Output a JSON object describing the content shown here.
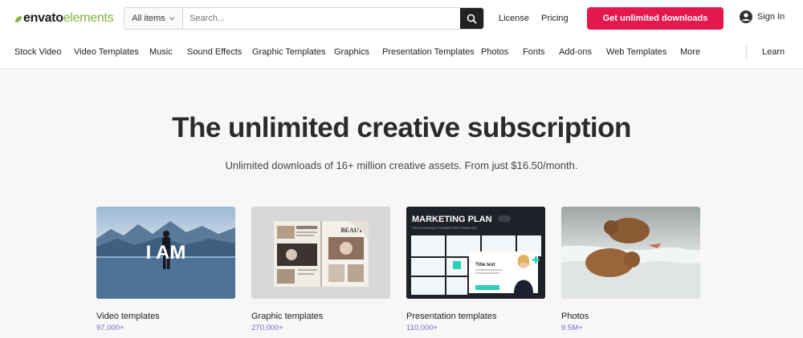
{
  "brand": {
    "logo_part1": "envato",
    "logo_part2": "elements",
    "accent": "#82b541",
    "cta_color": "#e4174f"
  },
  "search": {
    "category": "All items",
    "placeholder": "Search..."
  },
  "header": {
    "license": "License",
    "pricing": "Pricing",
    "cta": "Get unlimited downloads",
    "signin": "Sign In"
  },
  "nav": {
    "items": [
      "Stock Video",
      "Video Templates",
      "Music",
      "Sound Effects",
      "Graphic Templates",
      "Graphics",
      "Presentation Templates",
      "Photos",
      "Fonts",
      "Add-ons",
      "Web Templates",
      "More"
    ],
    "learn": "Learn"
  },
  "hero": {
    "title": "The unlimited creative subscription",
    "subtitle": "Unlimited downloads of 16+ million creative assets. From just $16.50/month."
  },
  "cards": [
    {
      "title": "Video templates",
      "count": "97,000+",
      "overlay": "I AM"
    },
    {
      "title": "Graphic templates",
      "count": "270,000+",
      "overlay": "BEAUTY"
    },
    {
      "title": "Presentation templates",
      "count": "110,000+",
      "overlay": "MARKETING PLAN",
      "overlay_sub": "PROFESSIONAL POWERPOINT TEMPLATE",
      "overlay_box": "Title text"
    },
    {
      "title": "Photos",
      "count": "9.5M+"
    }
  ]
}
